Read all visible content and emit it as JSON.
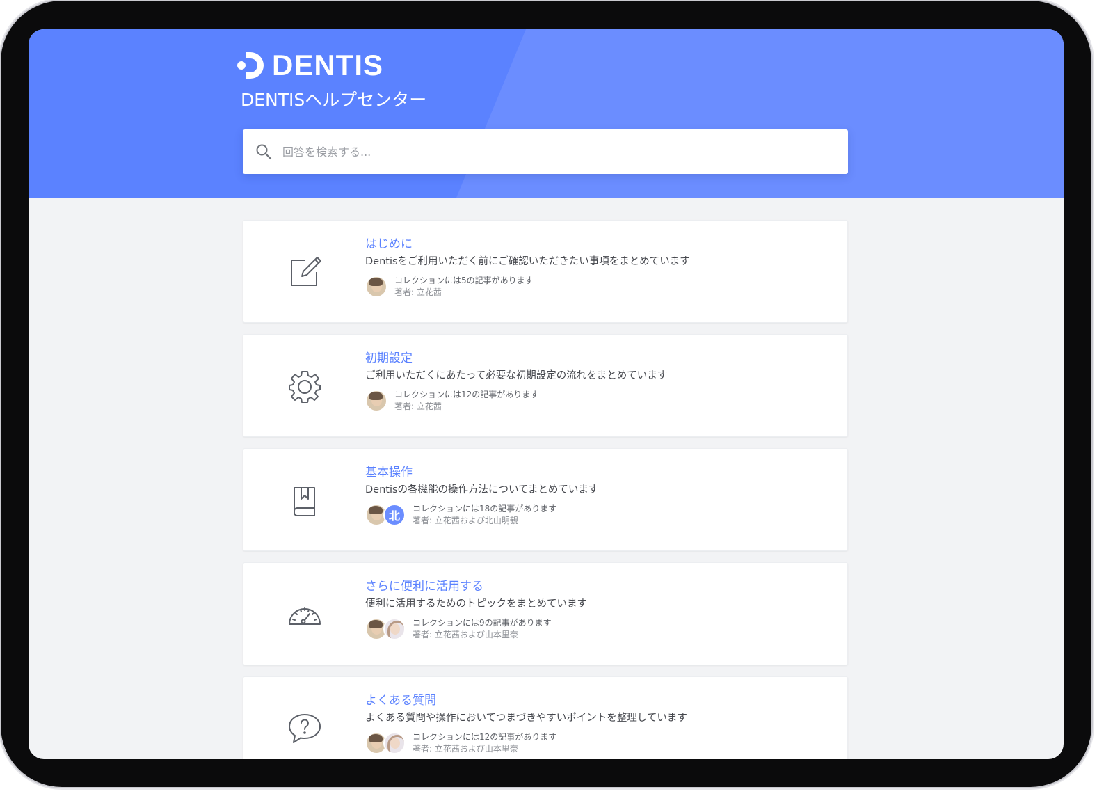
{
  "brand": {
    "logo_icon": "dentis-logo-icon",
    "name": "DENTIS",
    "primary_color": "#5b82ff"
  },
  "hero": {
    "title": "DENTISヘルプセンター"
  },
  "search": {
    "icon": "search-icon",
    "placeholder": "回答を検索する..."
  },
  "collections": [
    {
      "icon": "edit-icon",
      "title": "はじめに",
      "description": "Dentisをご利用いただく前にご確認いただきたい事項をまとめています",
      "article_count": "コレクションには5の記事があります",
      "authors": "著者: 立花茜"
    },
    {
      "icon": "gear-icon",
      "title": "初期設定",
      "description": "ご利用いただくにあたって必要な初期設定の流れをまとめています",
      "article_count": "コレクションには12の記事があります",
      "authors": "著者: 立花茜"
    },
    {
      "icon": "book-bookmark-icon",
      "title": "基本操作",
      "description": "Dentisの各機能の操作方法についてまとめています",
      "article_count": "コレクションには18の記事があります",
      "authors": "著者: 立花茜および北山明親",
      "avatar_initial": "北"
    },
    {
      "icon": "speedometer-icon",
      "title": "さらに便利に活用する",
      "description": "便利に活用するためのトピックをまとめています",
      "article_count": "コレクションには9の記事があります",
      "authors": "著者: 立花茜および山本里奈"
    },
    {
      "icon": "question-bubble-icon",
      "title": "よくある質問",
      "description": "よくある質問や操作においてつまづきやすいポイントを整理しています",
      "article_count": "コレクションには12の記事があります",
      "authors": "著者: 立花茜および山本里奈"
    }
  ]
}
